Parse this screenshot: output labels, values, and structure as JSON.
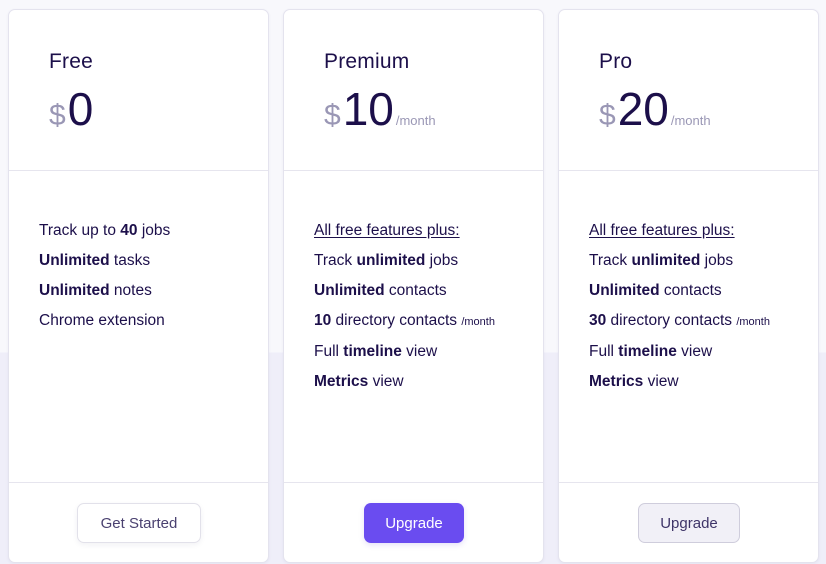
{
  "plans": [
    {
      "name": "Free",
      "currency": "$",
      "amount": "0",
      "period": "",
      "features": [
        {
          "parts": [
            {
              "t": "Track up to "
            },
            {
              "t": "40",
              "b": true
            },
            {
              "t": " jobs"
            }
          ]
        },
        {
          "parts": [
            {
              "t": "Unlimited",
              "b": true
            },
            {
              "t": " tasks"
            }
          ]
        },
        {
          "parts": [
            {
              "t": "Unlimited",
              "b": true
            },
            {
              "t": " notes"
            }
          ]
        },
        {
          "parts": [
            {
              "t": "Chrome extension"
            }
          ]
        }
      ],
      "button": {
        "label": "Get Started",
        "style": "outline"
      }
    },
    {
      "name": "Premium",
      "currency": "$",
      "amount": "10",
      "period": "/month",
      "features_heading": "All free features plus:",
      "features": [
        {
          "parts": [
            {
              "t": "Track "
            },
            {
              "t": "unlimited",
              "b": true
            },
            {
              "t": " jobs"
            }
          ]
        },
        {
          "parts": [
            {
              "t": "Unlimited",
              "b": true
            },
            {
              "t": " contacts"
            }
          ]
        },
        {
          "parts": [
            {
              "t": "10",
              "b": true
            },
            {
              "t": " directory contacts "
            },
            {
              "t": "/month",
              "s": true
            }
          ]
        },
        {
          "parts": [
            {
              "t": "Full "
            },
            {
              "t": "timeline",
              "b": true
            },
            {
              "t": " view"
            }
          ]
        },
        {
          "parts": [
            {
              "t": "Metrics",
              "b": true
            },
            {
              "t": " view"
            }
          ]
        }
      ],
      "button": {
        "label": "Upgrade",
        "style": "primary"
      }
    },
    {
      "name": "Pro",
      "currency": "$",
      "amount": "20",
      "period": "/month",
      "features_heading": "All free features plus:",
      "features": [
        {
          "parts": [
            {
              "t": "Track "
            },
            {
              "t": "unlimited",
              "b": true
            },
            {
              "t": " jobs"
            }
          ]
        },
        {
          "parts": [
            {
              "t": "Unlimited",
              "b": true
            },
            {
              "t": " contacts"
            }
          ]
        },
        {
          "parts": [
            {
              "t": "30",
              "b": true
            },
            {
              "t": " directory contacts "
            },
            {
              "t": "/month",
              "s": true
            }
          ]
        },
        {
          "parts": [
            {
              "t": "Full "
            },
            {
              "t": "timeline",
              "b": true
            },
            {
              "t": " view"
            }
          ]
        },
        {
          "parts": [
            {
              "t": "Metrics",
              "b": true
            },
            {
              "t": " view"
            }
          ]
        }
      ],
      "button": {
        "label": "Upgrade",
        "style": "secondary"
      }
    }
  ],
  "colors": {
    "primary": "#6a4cf0",
    "text": "#1c0f4a",
    "muted": "#9a97b5"
  }
}
